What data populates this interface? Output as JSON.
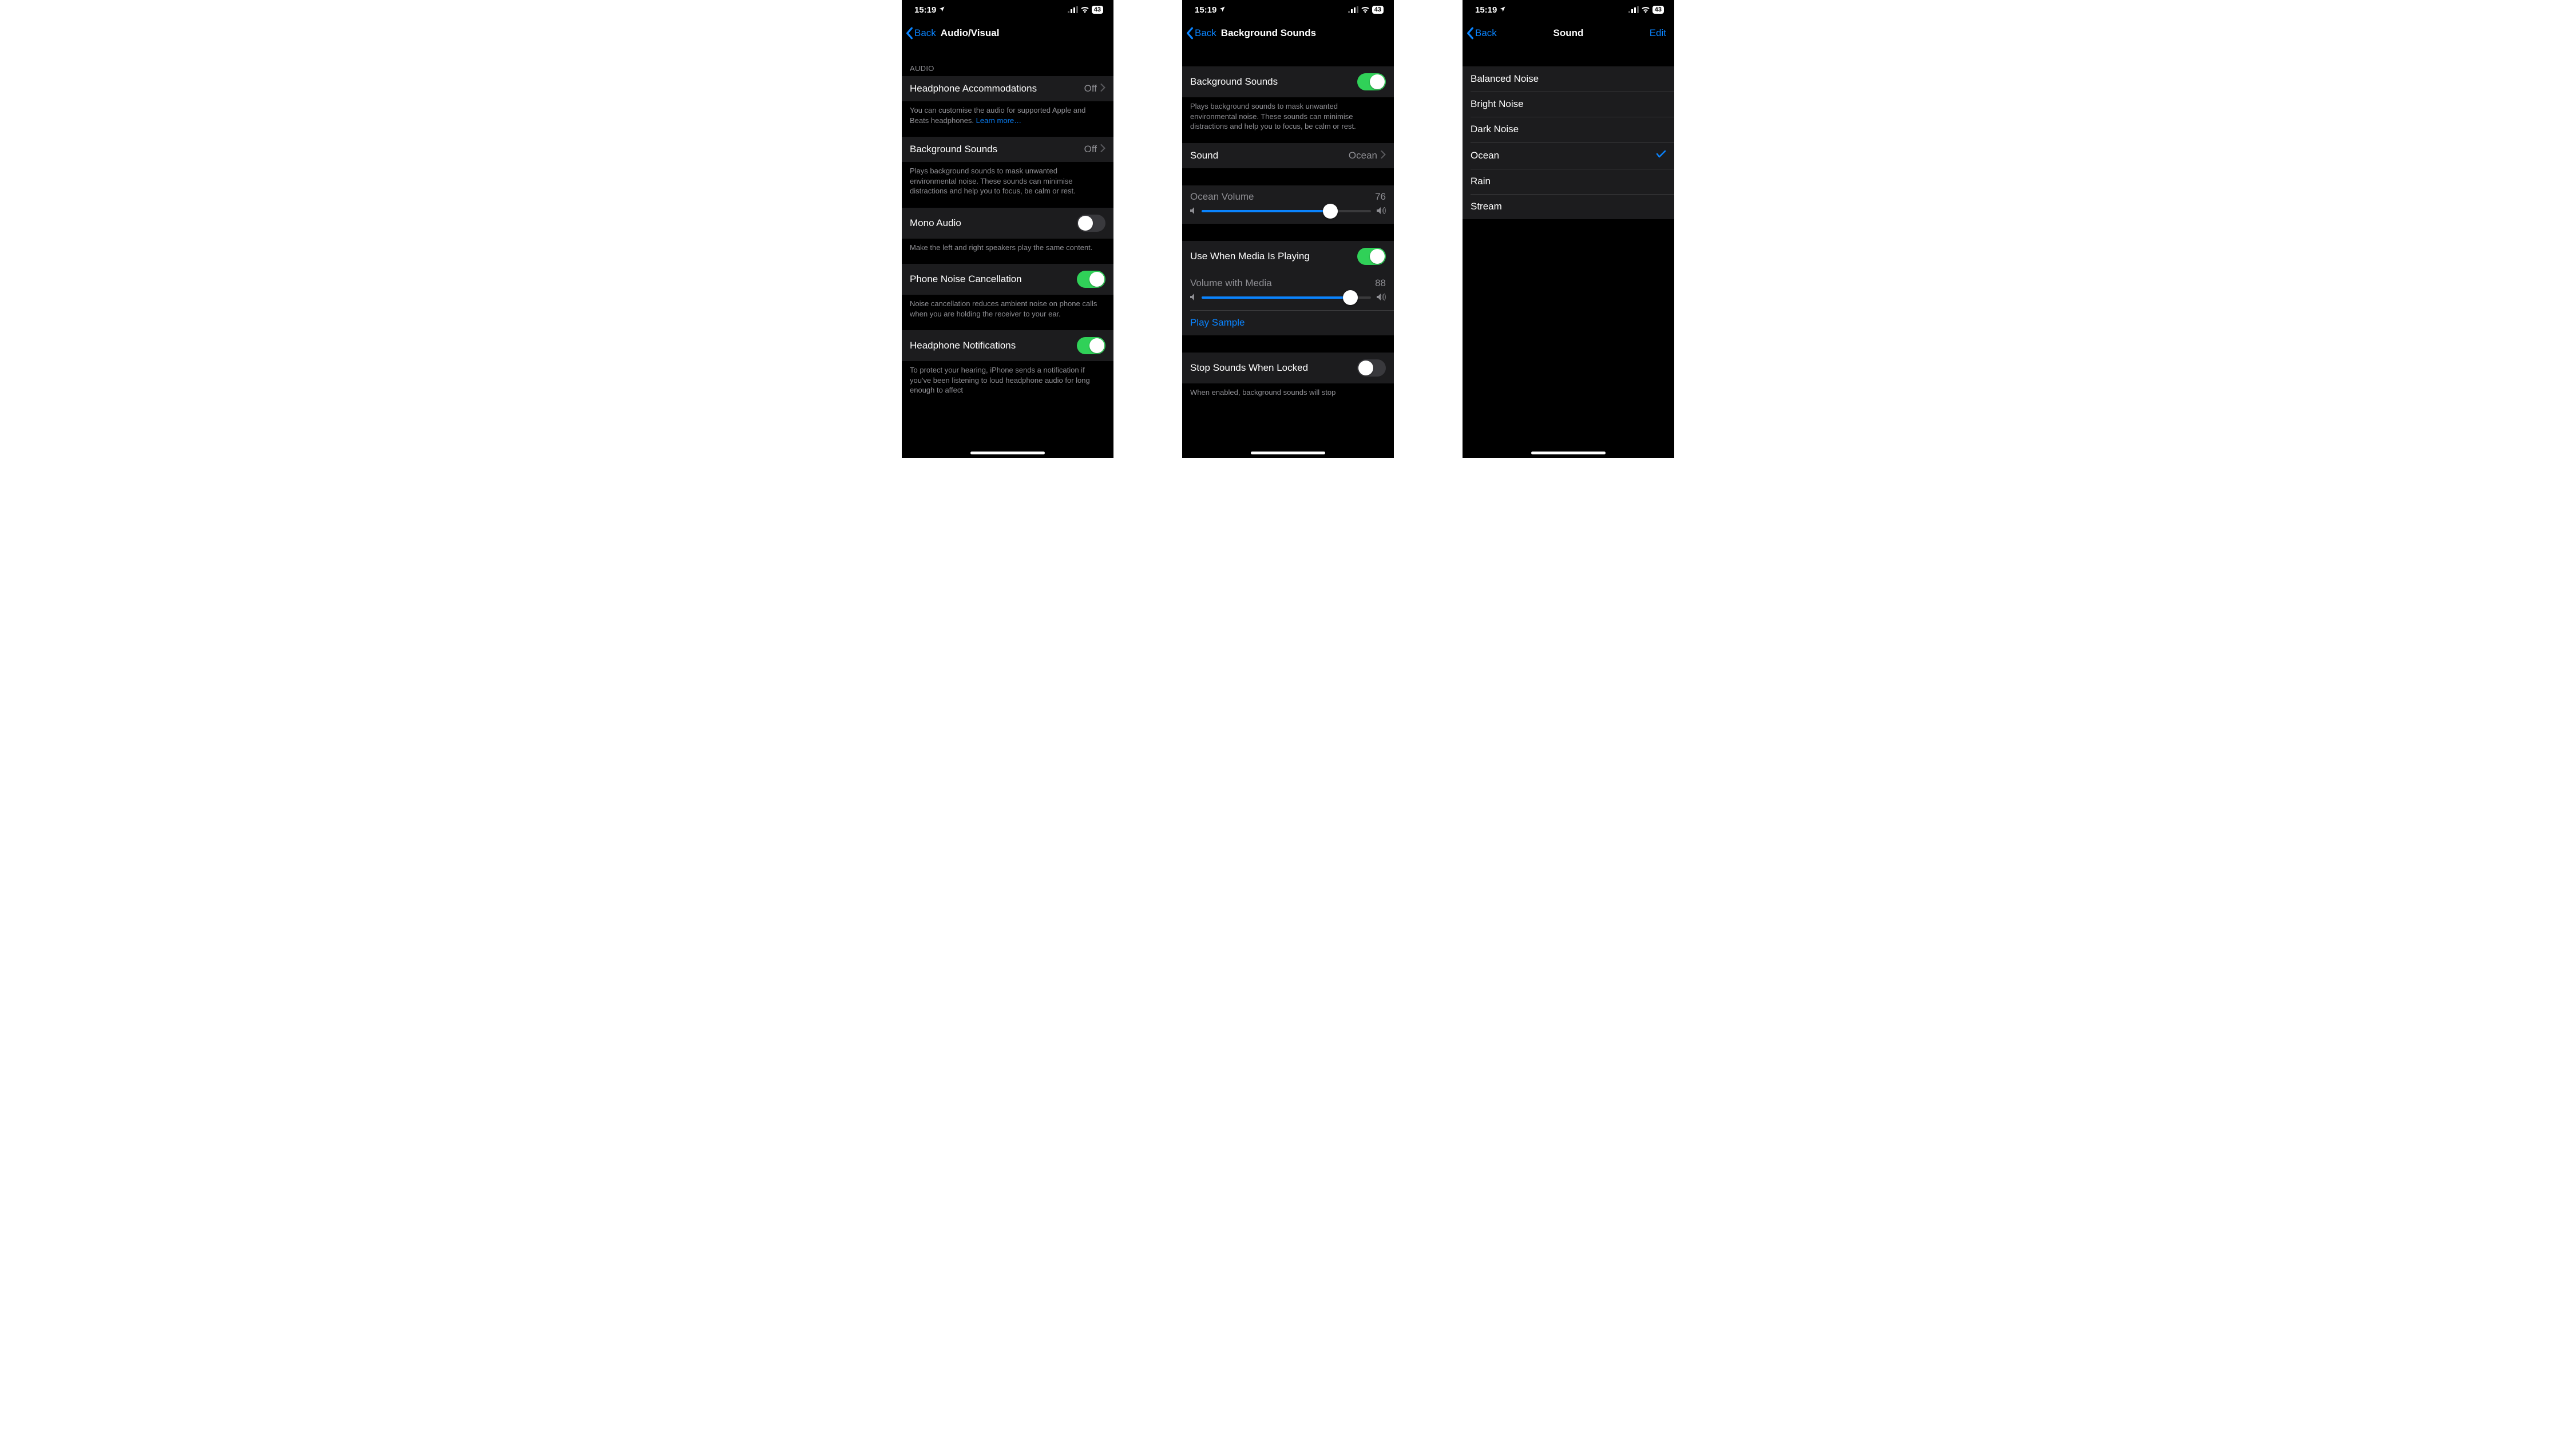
{
  "status": {
    "time": "15:19",
    "battery": "43"
  },
  "screen1": {
    "back": "Back",
    "title": "Audio/Visual",
    "section_audio": "AUDIO",
    "rows": {
      "headphone_accom": {
        "label": "Headphone Accommodations",
        "value": "Off"
      },
      "headphone_accom_footer": "You can customise the audio for supported Apple and Beats headphones. ",
      "learn_more": "Learn more…",
      "bg_sounds": {
        "label": "Background Sounds",
        "value": "Off"
      },
      "bg_sounds_footer": "Plays background sounds to mask unwanted environmental noise. These sounds can minimise distractions and help you to focus, be calm or rest.",
      "mono": {
        "label": "Mono Audio"
      },
      "mono_footer": "Make the left and right speakers play the same content.",
      "noise_cancel": {
        "label": "Phone Noise Cancellation"
      },
      "noise_cancel_footer": "Noise cancellation reduces ambient noise on phone calls when you are holding the receiver to your ear.",
      "hp_notif": {
        "label": "Headphone Notifications"
      },
      "hp_notif_footer": "To protect your hearing, iPhone sends a notification if you've been listening to loud headphone audio for long enough to affect"
    }
  },
  "screen2": {
    "back": "Back",
    "title": "Background Sounds",
    "rows": {
      "bg_sounds": {
        "label": "Background Sounds"
      },
      "bg_sounds_footer": "Plays background sounds to mask unwanted environmental noise. These sounds can minimise distractions and help you to focus, be calm or rest.",
      "sound": {
        "label": "Sound",
        "value": "Ocean"
      },
      "ocean_vol": {
        "label": "Ocean Volume",
        "value": "76"
      },
      "use_media": {
        "label": "Use When Media Is Playing"
      },
      "media_vol": {
        "label": "Volume with Media",
        "value": "88"
      },
      "play_sample": "Play Sample",
      "stop_locked": {
        "label": "Stop Sounds When Locked"
      },
      "stop_locked_footer": "When enabled, background sounds will stop"
    }
  },
  "screen3": {
    "back": "Back",
    "title": "Sound",
    "edit": "Edit",
    "options": [
      "Balanced Noise",
      "Bright Noise",
      "Dark Noise",
      "Ocean",
      "Rain",
      "Stream"
    ],
    "selected": "Ocean"
  }
}
